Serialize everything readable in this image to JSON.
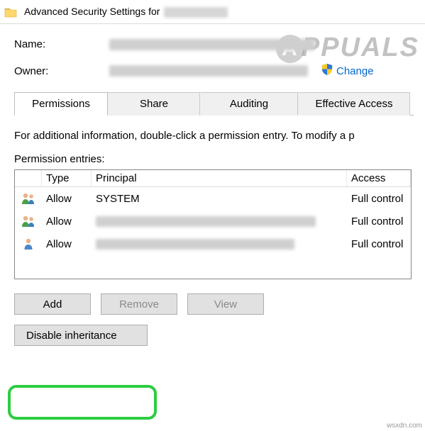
{
  "window": {
    "title_prefix": "Advanced Security Settings for"
  },
  "labels": {
    "name": "Name:",
    "owner": "Owner:",
    "change": "Change",
    "permission_entries": "Permission entries:"
  },
  "tabs": {
    "permissions": "Permissions",
    "share": "Share",
    "auditing": "Auditing",
    "effective": "Effective Access"
  },
  "info_text": "For additional information, double-click a permission entry. To modify a p",
  "columns": {
    "type": "Type",
    "principal": "Principal",
    "access": "Access"
  },
  "entries": [
    {
      "icon": "group",
      "type": "Allow",
      "principal": "SYSTEM",
      "principal_redacted": false,
      "access": "Full control"
    },
    {
      "icon": "group",
      "type": "Allow",
      "principal": "",
      "principal_redacted": true,
      "access": "Full control"
    },
    {
      "icon": "person",
      "type": "Allow",
      "principal": "",
      "principal_redacted": true,
      "access": "Full control"
    }
  ],
  "buttons": {
    "add": "Add",
    "remove": "Remove",
    "view": "View",
    "disable_inheritance": "Disable inheritance"
  },
  "watermark": "PPUALS",
  "source_tag": "wsxdn.com"
}
